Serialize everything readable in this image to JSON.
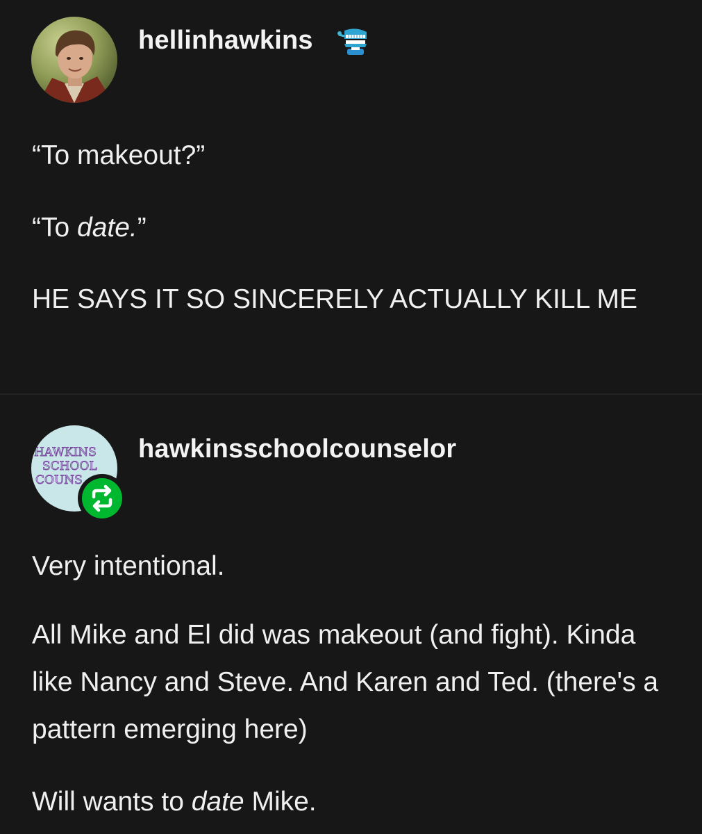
{
  "posts": [
    {
      "username": "hellinhawkins",
      "avatar_icon": "profile-photo-avatar",
      "badge_icon": "wind-up-chattering-teeth-icon",
      "paragraphs": {
        "p1": "“To makeout?”",
        "p2_prefix": "“To ",
        "p2_em": "date.",
        "p2_suffix": "”",
        "p3": "HE SAYS IT SO SINCERELY ACTUALLY KILL ME"
      }
    },
    {
      "username": "hawkinsschoolcounselor",
      "avatar_text": {
        "line1": "HAWKINS",
        "line2": "SCHOOL",
        "line3": "COUNS"
      },
      "reblog_icon": "reblog-icon",
      "paragraphs": {
        "p1": "Very intentional.",
        "p2": "All Mike and El did was makeout (and fight). Kinda like Nancy and Steve. And Karen and Ted. (there's a pattern emerging here)",
        "p3_prefix": "Will wants to ",
        "p3_em": "date",
        "p3_suffix": " Mike."
      }
    }
  ],
  "colors": {
    "background": "#171717",
    "text": "#f0f0f0",
    "reblog_green": "#00b82f"
  }
}
